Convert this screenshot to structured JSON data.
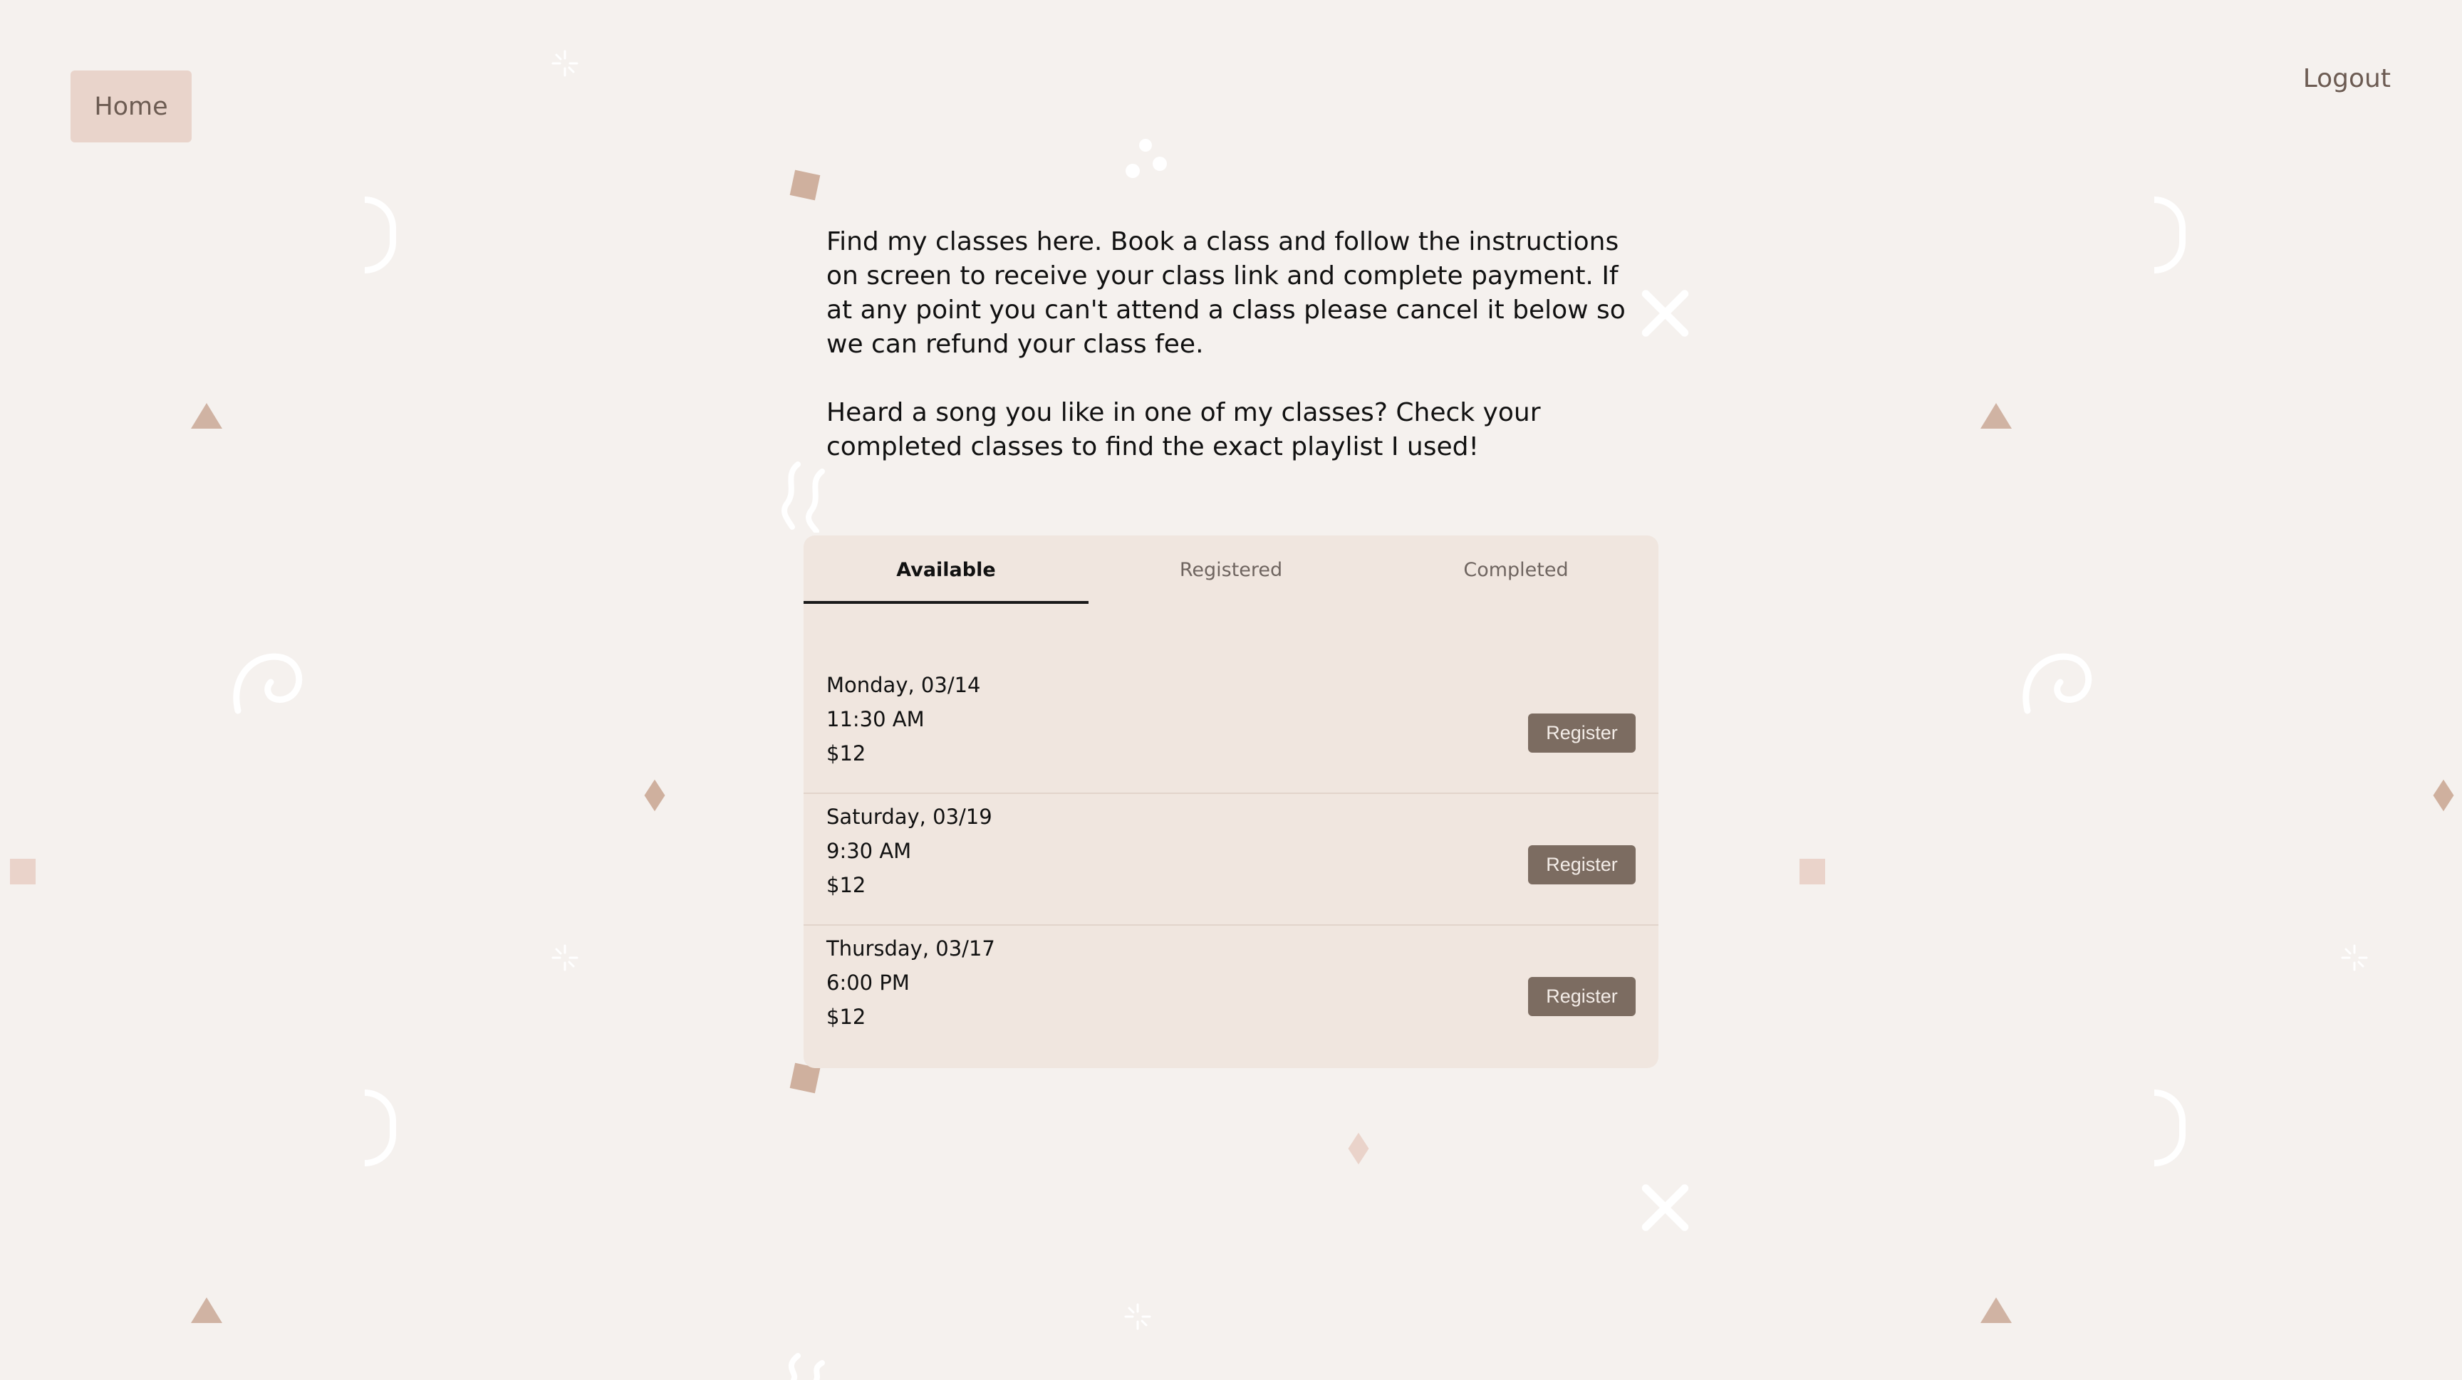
{
  "nav": {
    "home_label": "Home",
    "logout_label": "Logout"
  },
  "intro": {
    "paragraph_1": "Find my classes here. Book a class and follow the instructions on screen to receive your class link and complete payment. If at any point you can't attend a class please cancel it below so we can refund your class fee.",
    "paragraph_2": "Heard a song you like in one of my classes? Check your completed classes to find the exact playlist I used!"
  },
  "tabs": [
    {
      "label": "Available",
      "active": true
    },
    {
      "label": "Registered",
      "active": false
    },
    {
      "label": "Completed",
      "active": false
    }
  ],
  "classes": [
    {
      "day": "Monday, 03/14",
      "time": "11:30 AM",
      "price": "$12",
      "action": "Register"
    },
    {
      "day": "Saturday, 03/19",
      "time": "9:30 AM",
      "price": "$12",
      "action": "Register"
    },
    {
      "day": "Thursday, 03/17",
      "time": "6:00 PM",
      "price": "$12",
      "action": "Register"
    }
  ],
  "colors": {
    "background": "#f5f1ee",
    "card": "#f0e6df",
    "home_button": "#e9d4cb",
    "register_button": "#7c6c61",
    "accent_shape": "#cfb09e"
  }
}
